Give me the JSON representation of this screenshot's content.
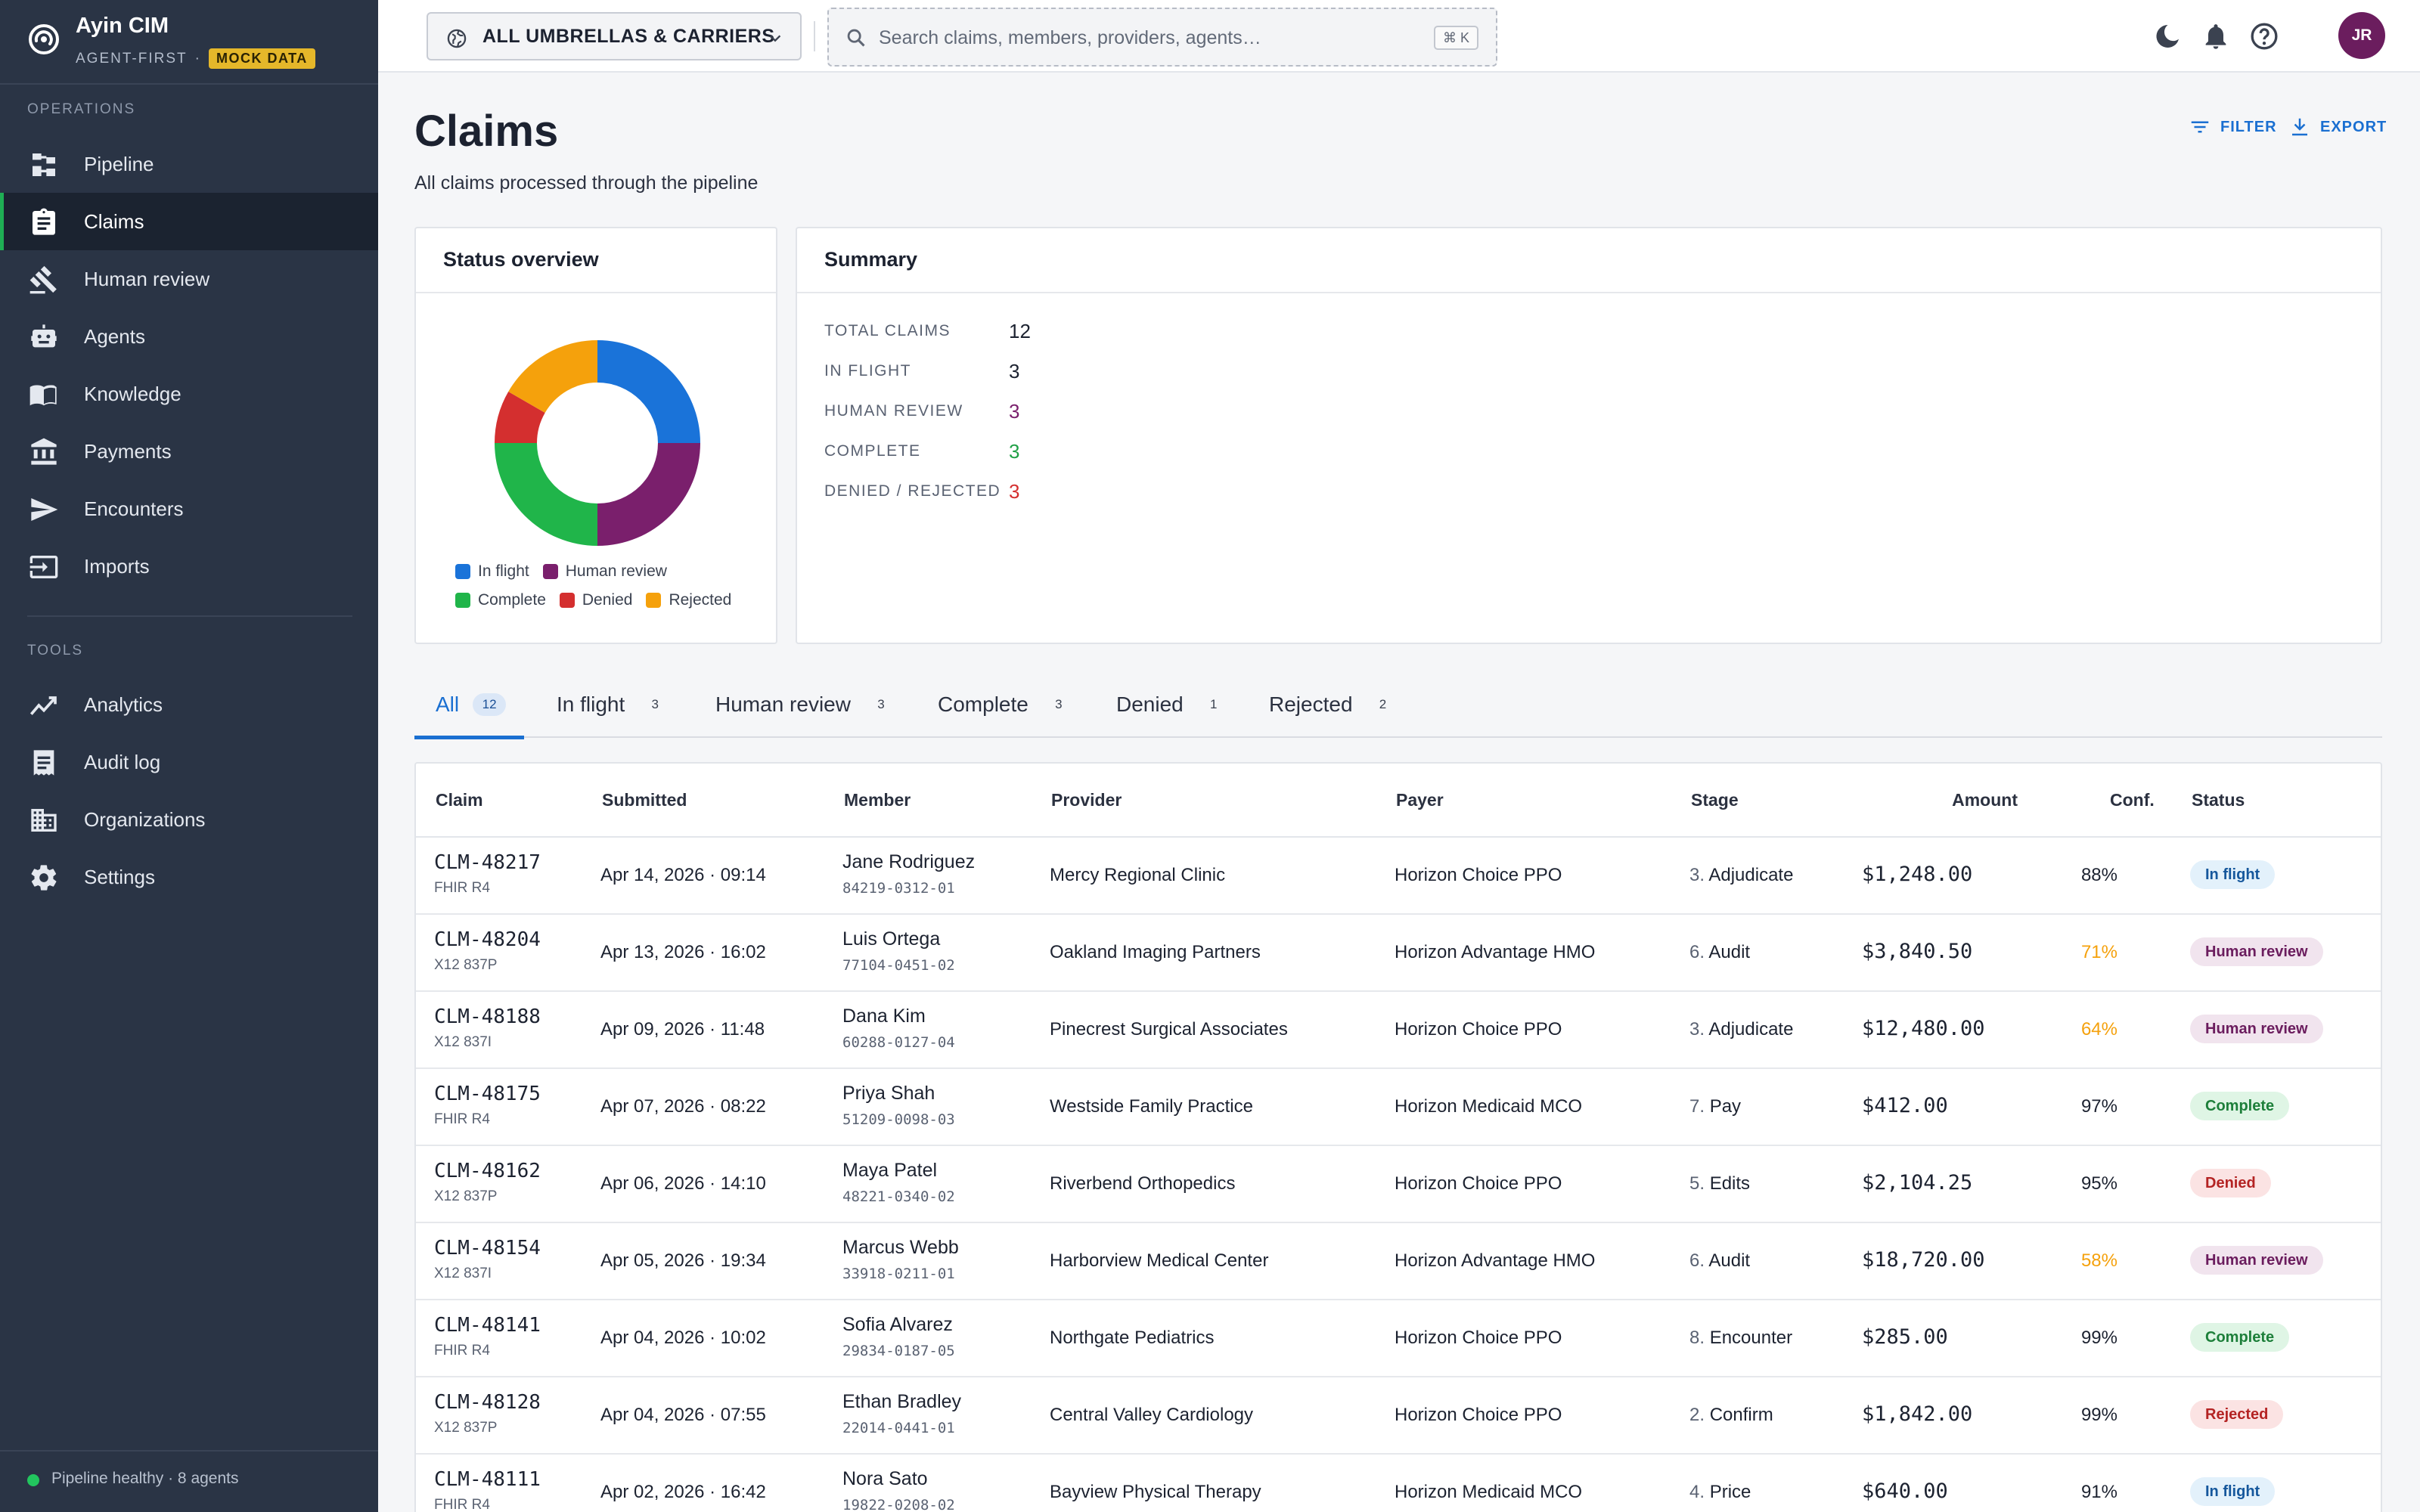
{
  "brand": {
    "name": "Ayin CIM",
    "subtitle": "AGENT-FIRST",
    "separator": "·",
    "badge": "MOCK DATA"
  },
  "sidebar": {
    "sections": [
      {
        "title": "OPERATIONS",
        "items": [
          {
            "label": "Pipeline",
            "icon": "pipeline-icon"
          },
          {
            "label": "Claims",
            "icon": "clipboard-icon",
            "active": true
          },
          {
            "label": "Human review",
            "icon": "gavel-icon"
          },
          {
            "label": "Agents",
            "icon": "robot-icon"
          },
          {
            "label": "Knowledge",
            "icon": "book-icon"
          },
          {
            "label": "Payments",
            "icon": "bank-icon"
          },
          {
            "label": "Encounters",
            "icon": "send-icon"
          },
          {
            "label": "Imports",
            "icon": "import-icon"
          }
        ]
      },
      {
        "title": "TOOLS",
        "items": [
          {
            "label": "Analytics",
            "icon": "trend-icon"
          },
          {
            "label": "Audit log",
            "icon": "receipt-icon"
          },
          {
            "label": "Organizations",
            "icon": "building-icon"
          },
          {
            "label": "Settings",
            "icon": "gear-icon"
          }
        ]
      }
    ],
    "footer": {
      "status": "Pipeline healthy · 8 agents",
      "status_color": "#22c55e"
    }
  },
  "topbar": {
    "scope_label": "ALL UMBRELLAS & CARRIERS",
    "search_placeholder": "Search claims, members, providers, agents…",
    "shortcut": "⌘ K",
    "avatar_initials": "JR",
    "avatar_color": "#6b1d5e"
  },
  "page": {
    "title": "Claims",
    "subtitle": "All claims processed through the pipeline",
    "actions": {
      "filter": "FILTER",
      "export": "EXPORT"
    }
  },
  "status_overview": {
    "title": "Status overview",
    "legend": [
      {
        "label": "In flight",
        "color": "#1a73d9"
      },
      {
        "label": "Human review",
        "color": "#7a1f6c"
      },
      {
        "label": "Complete",
        "color": "#20b54a"
      },
      {
        "label": "Denied",
        "color": "#d42f2f"
      },
      {
        "label": "Rejected",
        "color": "#f5a10c"
      }
    ]
  },
  "chart_data": {
    "type": "pie",
    "title": "Status overview",
    "categories": [
      "In flight",
      "Human review",
      "Complete",
      "Denied",
      "Rejected"
    ],
    "values": [
      3,
      3,
      3,
      1,
      2
    ],
    "colors": [
      "#1a73d9",
      "#7a1f6c",
      "#20b54a",
      "#d42f2f",
      "#f5a10c"
    ],
    "donut": true,
    "legend": "bottom"
  },
  "summary": {
    "title": "Summary",
    "rows": [
      {
        "label": "TOTAL CLAIMS",
        "value": "12",
        "color": "#1c2230"
      },
      {
        "label": "IN FLIGHT",
        "value": "3",
        "color": "#1c2230"
      },
      {
        "label": "HUMAN REVIEW",
        "value": "3",
        "color": "#7a1f6c"
      },
      {
        "label": "COMPLETE",
        "value": "3",
        "color": "#20a046"
      },
      {
        "label": "DENIED / REJECTED",
        "value": "3",
        "color": "#d42f2f"
      }
    ]
  },
  "tabs": [
    {
      "label": "All",
      "count": "12",
      "active": true
    },
    {
      "label": "In flight",
      "count": "3"
    },
    {
      "label": "Human review",
      "count": "3"
    },
    {
      "label": "Complete",
      "count": "3"
    },
    {
      "label": "Denied",
      "count": "1"
    },
    {
      "label": "Rejected",
      "count": "2"
    }
  ],
  "table": {
    "columns": [
      "Claim",
      "Submitted",
      "Member",
      "Provider",
      "Payer",
      "Stage",
      "Amount",
      "Conf.",
      "Status"
    ],
    "rows": [
      {
        "claim": "CLM-48217",
        "format": "FHIR R4",
        "submitted": "Apr 14, 2026 · 09:14",
        "member": "Jane Rodriguez",
        "member_id": "84219-0312-01",
        "provider": "Mercy Regional Clinic",
        "payer": "Horizon Choice PPO",
        "stage_num": "3.",
        "stage": "Adjudicate",
        "amount": "$1,248.00",
        "conf": "88%",
        "conf_color": "#1c2230",
        "status": "In flight"
      },
      {
        "claim": "CLM-48204",
        "format": "X12 837P",
        "submitted": "Apr 13, 2026 · 16:02",
        "member": "Luis Ortega",
        "member_id": "77104-0451-02",
        "provider": "Oakland Imaging Partners",
        "payer": "Horizon Advantage HMO",
        "stage_num": "6.",
        "stage": "Audit",
        "amount": "$3,840.50",
        "conf": "71%",
        "conf_color": "#f5a10c",
        "status": "Human review"
      },
      {
        "claim": "CLM-48188",
        "format": "X12 837I",
        "submitted": "Apr 09, 2026 · 11:48",
        "member": "Dana Kim",
        "member_id": "60288-0127-04",
        "provider": "Pinecrest Surgical Associates",
        "payer": "Horizon Choice PPO",
        "stage_num": "3.",
        "stage": "Adjudicate",
        "amount": "$12,480.00",
        "conf": "64%",
        "conf_color": "#f5a10c",
        "status": "Human review"
      },
      {
        "claim": "CLM-48175",
        "format": "FHIR R4",
        "submitted": "Apr 07, 2026 · 08:22",
        "member": "Priya Shah",
        "member_id": "51209-0098-03",
        "provider": "Westside Family Practice",
        "payer": "Horizon Medicaid MCO",
        "stage_num": "7.",
        "stage": "Pay",
        "amount": "$412.00",
        "conf": "97%",
        "conf_color": "#1c2230",
        "status": "Complete"
      },
      {
        "claim": "CLM-48162",
        "format": "X12 837P",
        "submitted": "Apr 06, 2026 · 14:10",
        "member": "Maya Patel",
        "member_id": "48221-0340-02",
        "provider": "Riverbend Orthopedics",
        "payer": "Horizon Choice PPO",
        "stage_num": "5.",
        "stage": "Edits",
        "amount": "$2,104.25",
        "conf": "95%",
        "conf_color": "#1c2230",
        "status": "Denied"
      },
      {
        "claim": "CLM-48154",
        "format": "X12 837I",
        "submitted": "Apr 05, 2026 · 19:34",
        "member": "Marcus Webb",
        "member_id": "33918-0211-01",
        "provider": "Harborview Medical Center",
        "payer": "Horizon Advantage HMO",
        "stage_num": "6.",
        "stage": "Audit",
        "amount": "$18,720.00",
        "conf": "58%",
        "conf_color": "#f5a10c",
        "status": "Human review"
      },
      {
        "claim": "CLM-48141",
        "format": "FHIR R4",
        "submitted": "Apr 04, 2026 · 10:02",
        "member": "Sofia Alvarez",
        "member_id": "29834-0187-05",
        "provider": "Northgate Pediatrics",
        "payer": "Horizon Choice PPO",
        "stage_num": "8.",
        "stage": "Encounter",
        "amount": "$285.00",
        "conf": "99%",
        "conf_color": "#1c2230",
        "status": "Complete"
      },
      {
        "claim": "CLM-48128",
        "format": "X12 837P",
        "submitted": "Apr 04, 2026 · 07:55",
        "member": "Ethan Bradley",
        "member_id": "22014-0441-01",
        "provider": "Central Valley Cardiology",
        "payer": "Horizon Choice PPO",
        "stage_num": "2.",
        "stage": "Confirm",
        "amount": "$1,842.00",
        "conf": "99%",
        "conf_color": "#1c2230",
        "status": "Rejected"
      },
      {
        "claim": "CLM-48111",
        "format": "FHIR R4",
        "submitted": "Apr 02, 2026 · 16:42",
        "member": "Nora Sato",
        "member_id": "19822-0208-02",
        "provider": "Bayview Physical Therapy",
        "payer": "Horizon Medicaid MCO",
        "stage_num": "4.",
        "stage": "Price",
        "amount": "$640.00",
        "conf": "91%",
        "conf_color": "#1c2230",
        "status": "In flight"
      }
    ]
  },
  "status_styles": {
    "In flight": {
      "bg": "#e3f1fb",
      "fg": "#15579c"
    },
    "Human review": {
      "bg": "#f1e4ee",
      "fg": "#6b1d5e"
    },
    "Complete": {
      "bg": "#dff5e5",
      "fg": "#1d7f3a"
    },
    "Denied": {
      "bg": "#fbe3e3",
      "fg": "#b42323"
    },
    "Rejected": {
      "bg": "#fbe3e3",
      "fg": "#b42323"
    }
  }
}
